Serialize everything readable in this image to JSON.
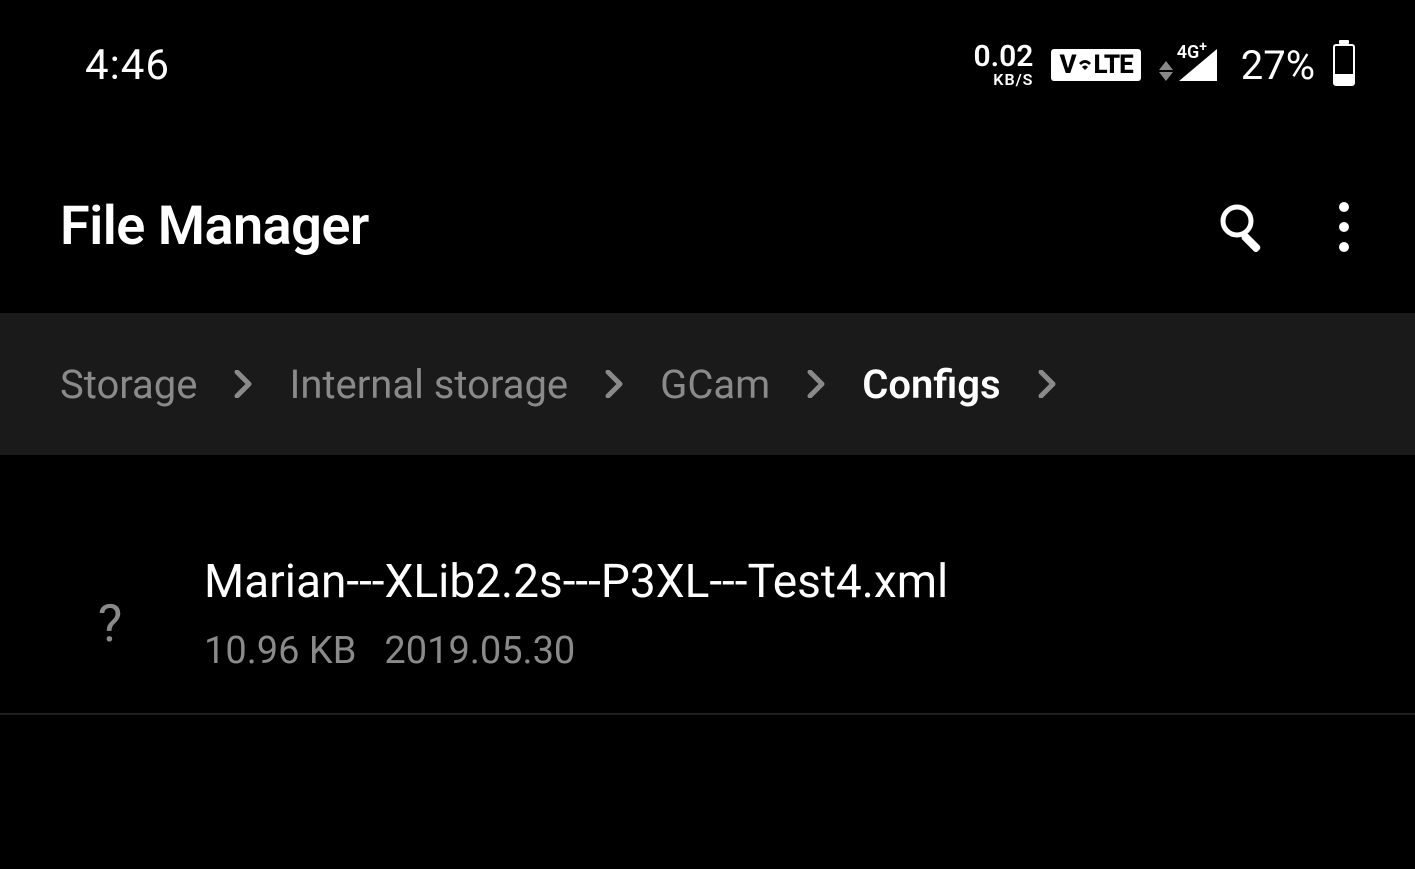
{
  "status": {
    "time": "4:46",
    "dataRateValue": "0.02",
    "dataRateUnit": "KB/S",
    "volte": "VoLTE",
    "networkLabel": "4G",
    "networkPlus": "+",
    "batteryPct": "27%"
  },
  "app": {
    "title": "File Manager"
  },
  "breadcrumb": {
    "items": [
      {
        "label": "Storage",
        "current": false
      },
      {
        "label": "Internal storage",
        "current": false
      },
      {
        "label": "GCam",
        "current": false
      },
      {
        "label": "Configs",
        "current": true
      }
    ]
  },
  "files": [
    {
      "icon": "?",
      "name": "Marian---XLib2.2s---P3XL---Test4.xml",
      "size": "10.96 KB",
      "date": "2019.05.30"
    }
  ]
}
